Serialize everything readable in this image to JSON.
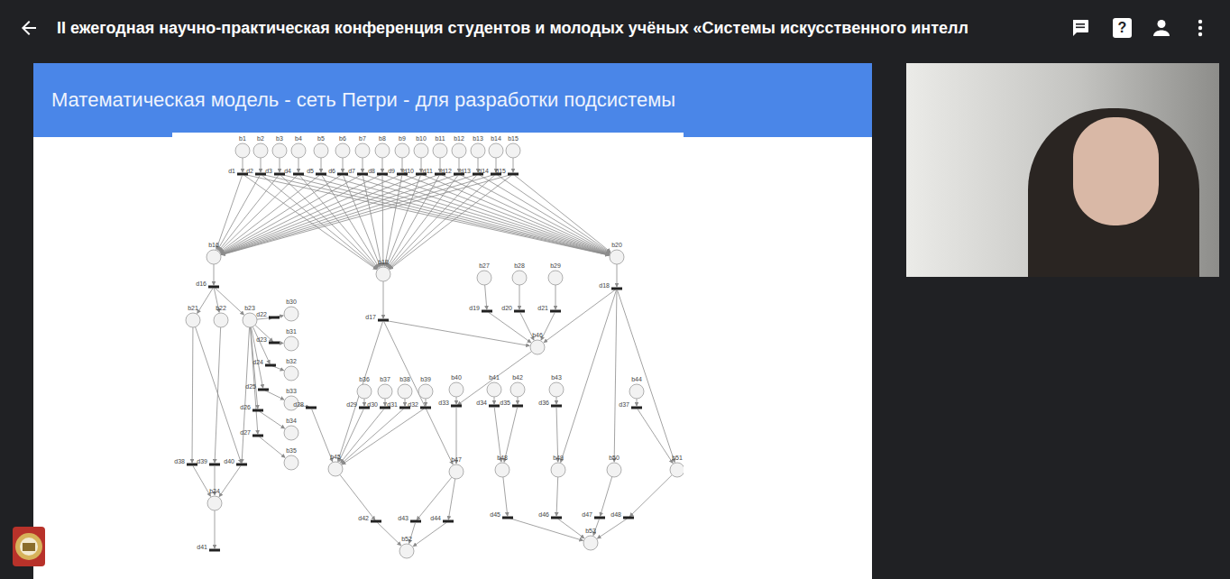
{
  "window": {
    "title": "II ежегодная научно-практическая конференция студентов и молодых учёных «Системы искусственного интелл",
    "help_icon": "?"
  },
  "slide": {
    "heading": "Математическая модель - сеть Петри - для разработки подсистемы",
    "diagram": {
      "places": [
        "b1",
        "b2",
        "b3",
        "b4",
        "b5",
        "b6",
        "b7",
        "b8",
        "b9",
        "b10",
        "b11",
        "b12",
        "b13",
        "b14",
        "b15",
        "b16",
        "b18",
        "b20",
        "b27",
        "b28",
        "b29",
        "b21",
        "b22",
        "b23",
        "b30",
        "b31",
        "b32",
        "b33",
        "b34",
        "b35",
        "b46",
        "b36",
        "b37",
        "b38",
        "b39",
        "b40",
        "b41",
        "b42",
        "b43",
        "b44",
        "b24",
        "b45",
        "b47",
        "b48",
        "b49",
        "b50",
        "b51",
        "b52",
        "b53"
      ],
      "transitions": [
        "d1",
        "d2",
        "d3",
        "d4",
        "d5",
        "d6",
        "d7",
        "d8",
        "d9",
        "d10",
        "d11",
        "d12",
        "d13",
        "d14",
        "d15",
        "d16",
        "d17",
        "d18",
        "d19",
        "d20",
        "d21",
        "d22",
        "d23",
        "d24",
        "d25",
        "d26",
        "d27",
        "d28",
        "d29",
        "d30",
        "d31",
        "d32",
        "d33",
        "d34",
        "d35",
        "d36",
        "d37",
        "d38",
        "d39",
        "d40",
        "d41",
        "d42",
        "d43",
        "d44",
        "d45",
        "d46",
        "d47",
        "d48"
      ],
      "arcs": [
        [
          "b1",
          "d1"
        ],
        [
          "b2",
          "d2"
        ],
        [
          "b3",
          "d3"
        ],
        [
          "b4",
          "d4"
        ],
        [
          "b5",
          "d5"
        ],
        [
          "b6",
          "d6"
        ],
        [
          "b7",
          "d7"
        ],
        [
          "b8",
          "d8"
        ],
        [
          "b9",
          "d9"
        ],
        [
          "b10",
          "d10"
        ],
        [
          "b11",
          "d11"
        ],
        [
          "b12",
          "d12"
        ],
        [
          "b13",
          "d13"
        ],
        [
          "b14",
          "d14"
        ],
        [
          "b15",
          "d15"
        ],
        [
          "d1",
          "b16"
        ],
        [
          "d2",
          "b16"
        ],
        [
          "d3",
          "b16"
        ],
        [
          "d4",
          "b16"
        ],
        [
          "d5",
          "b16"
        ],
        [
          "d6",
          "b16"
        ],
        [
          "d7",
          "b16"
        ],
        [
          "d8",
          "b16"
        ],
        [
          "d9",
          "b16"
        ],
        [
          "d10",
          "b16"
        ],
        [
          "d11",
          "b16"
        ],
        [
          "d12",
          "b16"
        ],
        [
          "d13",
          "b16"
        ],
        [
          "d14",
          "b16"
        ],
        [
          "d15",
          "b16"
        ],
        [
          "d1",
          "b18"
        ],
        [
          "d2",
          "b18"
        ],
        [
          "d3",
          "b18"
        ],
        [
          "d4",
          "b18"
        ],
        [
          "d5",
          "b18"
        ],
        [
          "d6",
          "b18"
        ],
        [
          "d7",
          "b18"
        ],
        [
          "d8",
          "b18"
        ],
        [
          "d9",
          "b18"
        ],
        [
          "d10",
          "b18"
        ],
        [
          "d11",
          "b18"
        ],
        [
          "d12",
          "b18"
        ],
        [
          "d13",
          "b18"
        ],
        [
          "d14",
          "b18"
        ],
        [
          "d15",
          "b18"
        ],
        [
          "d1",
          "b20"
        ],
        [
          "d2",
          "b20"
        ],
        [
          "d3",
          "b20"
        ],
        [
          "d4",
          "b20"
        ],
        [
          "d5",
          "b20"
        ],
        [
          "d6",
          "b20"
        ],
        [
          "d7",
          "b20"
        ],
        [
          "d8",
          "b20"
        ],
        [
          "d9",
          "b20"
        ],
        [
          "d10",
          "b20"
        ],
        [
          "d11",
          "b20"
        ],
        [
          "d12",
          "b20"
        ],
        [
          "d13",
          "b20"
        ],
        [
          "d14",
          "b20"
        ],
        [
          "d15",
          "b20"
        ],
        [
          "b16",
          "d16"
        ],
        [
          "d16",
          "b21"
        ],
        [
          "d16",
          "b22"
        ],
        [
          "d16",
          "b23"
        ],
        [
          "b23",
          "d22"
        ],
        [
          "b23",
          "d23"
        ],
        [
          "b23",
          "d24"
        ],
        [
          "b23",
          "d25"
        ],
        [
          "b23",
          "d26"
        ],
        [
          "b23",
          "d27"
        ],
        [
          "d22",
          "b30"
        ],
        [
          "d23",
          "b31"
        ],
        [
          "d24",
          "b32"
        ],
        [
          "d25",
          "b33"
        ],
        [
          "d26",
          "b34"
        ],
        [
          "d27",
          "b35"
        ],
        [
          "b21",
          "d38"
        ],
        [
          "b22",
          "d39"
        ],
        [
          "b23",
          "d40"
        ],
        [
          "b21",
          "d40"
        ],
        [
          "d38",
          "b24"
        ],
        [
          "d39",
          "b24"
        ],
        [
          "d40",
          "b24"
        ],
        [
          "b24",
          "d41"
        ],
        [
          "b18",
          "d17"
        ],
        [
          "d17",
          "b45"
        ],
        [
          "d17",
          "b47"
        ],
        [
          "d17",
          "b46"
        ],
        [
          "b27",
          "d19"
        ],
        [
          "b28",
          "d20"
        ],
        [
          "b29",
          "d21"
        ],
        [
          "d19",
          "b46"
        ],
        [
          "d20",
          "b46"
        ],
        [
          "d21",
          "b46"
        ],
        [
          "b20",
          "d18"
        ],
        [
          "d18",
          "b46"
        ],
        [
          "d18",
          "b49"
        ],
        [
          "d18",
          "b50"
        ],
        [
          "d18",
          "b51"
        ],
        [
          "b36",
          "d29"
        ],
        [
          "b37",
          "d30"
        ],
        [
          "b38",
          "d31"
        ],
        [
          "b39",
          "d32"
        ],
        [
          "b40",
          "d33"
        ],
        [
          "b41",
          "d34"
        ],
        [
          "b42",
          "d35"
        ],
        [
          "b43",
          "d36"
        ],
        [
          "b44",
          "d37"
        ],
        [
          "d29",
          "b45"
        ],
        [
          "d30",
          "b45"
        ],
        [
          "d31",
          "b45"
        ],
        [
          "d32",
          "b45"
        ],
        [
          "d33",
          "b47"
        ],
        [
          "d34",
          "b48"
        ],
        [
          "d35",
          "b48"
        ],
        [
          "d36",
          "b49"
        ],
        [
          "d37",
          "b51"
        ],
        [
          "b33",
          "d28"
        ],
        [
          "d28",
          "b45"
        ],
        [
          "b46",
          "d33"
        ],
        [
          "b45",
          "d42"
        ],
        [
          "b47",
          "d43"
        ],
        [
          "b47",
          "d44"
        ],
        [
          "b48",
          "d45"
        ],
        [
          "b49",
          "d46"
        ],
        [
          "b50",
          "d47"
        ],
        [
          "b51",
          "d48"
        ],
        [
          "d42",
          "b52"
        ],
        [
          "d43",
          "b52"
        ],
        [
          "d44",
          "b52"
        ],
        [
          "d45",
          "b53"
        ],
        [
          "d46",
          "b53"
        ],
        [
          "d47",
          "b53"
        ],
        [
          "d48",
          "b53"
        ]
      ]
    }
  }
}
